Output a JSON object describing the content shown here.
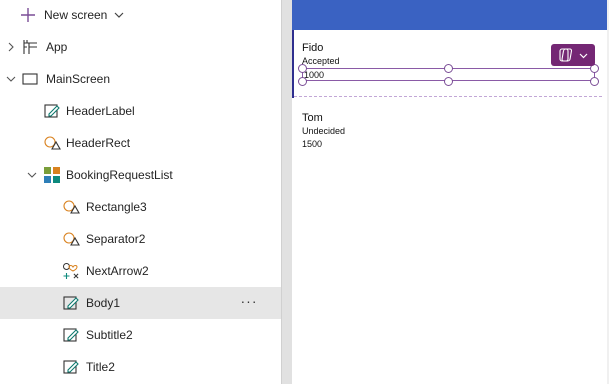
{
  "toolbar": {
    "new_screen_label": "New screen"
  },
  "tree": {
    "items": [
      {
        "label": "App"
      },
      {
        "label": "MainScreen"
      },
      {
        "label": "HeaderLabel"
      },
      {
        "label": "HeaderRect"
      },
      {
        "label": "BookingRequestList"
      },
      {
        "label": "Rectangle3"
      },
      {
        "label": "Separator2"
      },
      {
        "label": "NextArrow2"
      },
      {
        "label": "Body1"
      },
      {
        "label": "Subtitle2"
      },
      {
        "label": "Title2"
      }
    ],
    "more_label": "···"
  },
  "canvas": {
    "records": [
      {
        "title": "Fido",
        "subtitle": "Accepted",
        "body": "1000"
      },
      {
        "title": "Tom",
        "subtitle": "Undecided",
        "body": "1500"
      }
    ]
  },
  "colors": {
    "header": "#3a62c2",
    "selection": "#8a5aa6",
    "copilot": "#742774",
    "selected_row": "#e6e6e6"
  }
}
